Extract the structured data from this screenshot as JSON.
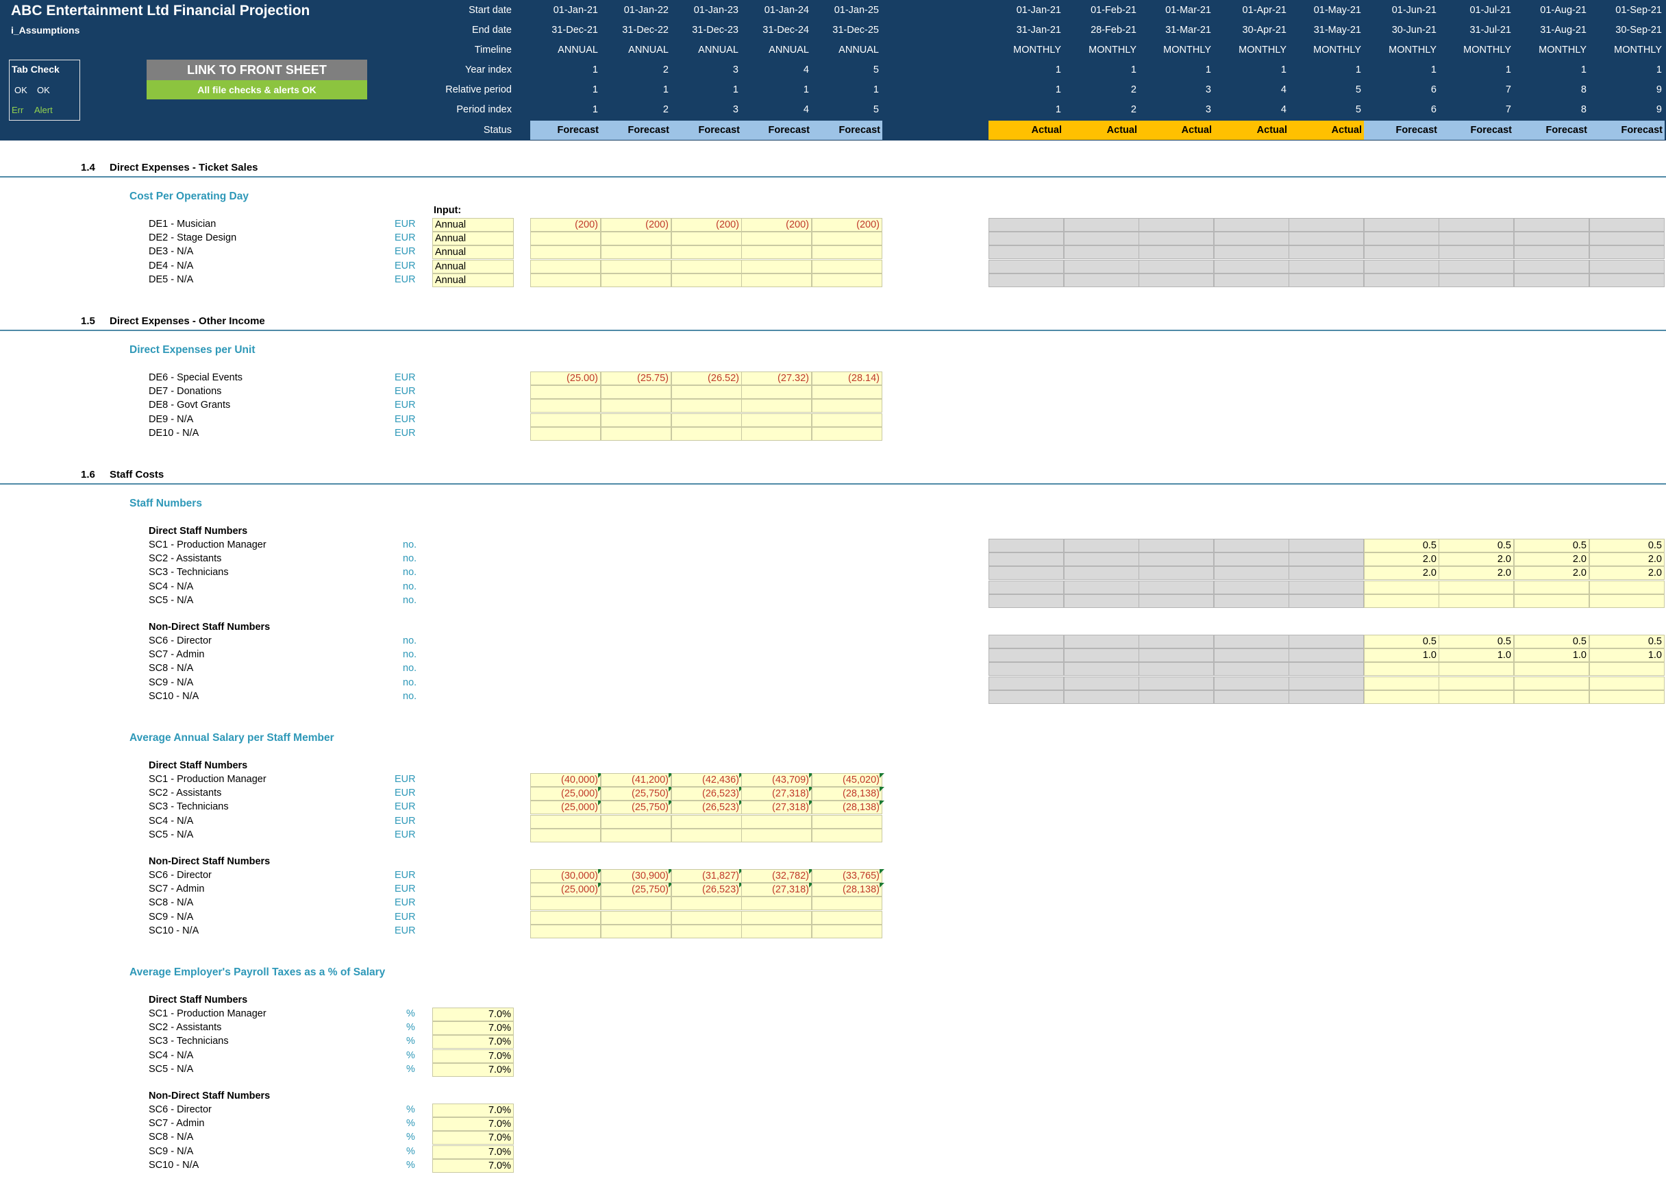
{
  "title": "ABC Entertainment Ltd Financial Projection",
  "sheet_name": "i_Assumptions",
  "tab_check": {
    "title": "Tab Check",
    "ok1": "OK",
    "ok2": "OK",
    "err": "Err",
    "alert": "Alert"
  },
  "link_button": "LINK TO FRONT SHEET",
  "alerts_status": "All file checks & alerts OK",
  "row_labels": {
    "start_date": "Start date",
    "end_date": "End date",
    "timeline": "Timeline",
    "year_index": "Year index",
    "relative_period": "Relative period",
    "period_index": "Period index",
    "status": "Status"
  },
  "annual_columns": [
    {
      "start": "01-Jan-21",
      "end": "31-Dec-21",
      "timeline": "ANNUAL",
      "year": "1",
      "rel": "1",
      "idx": "1",
      "status": "Forecast"
    },
    {
      "start": "01-Jan-22",
      "end": "31-Dec-22",
      "timeline": "ANNUAL",
      "year": "2",
      "rel": "1",
      "idx": "2",
      "status": "Forecast"
    },
    {
      "start": "01-Jan-23",
      "end": "31-Dec-23",
      "timeline": "ANNUAL",
      "year": "3",
      "rel": "1",
      "idx": "3",
      "status": "Forecast"
    },
    {
      "start": "01-Jan-24",
      "end": "31-Dec-24",
      "timeline": "ANNUAL",
      "year": "4",
      "rel": "1",
      "idx": "4",
      "status": "Forecast"
    },
    {
      "start": "01-Jan-25",
      "end": "31-Dec-25",
      "timeline": "ANNUAL",
      "year": "5",
      "rel": "1",
      "idx": "5",
      "status": "Forecast"
    }
  ],
  "monthly_columns": [
    {
      "start": "01-Jan-21",
      "end": "31-Jan-21",
      "timeline": "MONTHLY",
      "year": "1",
      "rel": "1",
      "idx": "1",
      "status": "Actual"
    },
    {
      "start": "01-Feb-21",
      "end": "28-Feb-21",
      "timeline": "MONTHLY",
      "year": "1",
      "rel": "2",
      "idx": "2",
      "status": "Actual"
    },
    {
      "start": "01-Mar-21",
      "end": "31-Mar-21",
      "timeline": "MONTHLY",
      "year": "1",
      "rel": "3",
      "idx": "3",
      "status": "Actual"
    },
    {
      "start": "01-Apr-21",
      "end": "30-Apr-21",
      "timeline": "MONTHLY",
      "year": "1",
      "rel": "4",
      "idx": "4",
      "status": "Actual"
    },
    {
      "start": "01-May-21",
      "end": "31-May-21",
      "timeline": "MONTHLY",
      "year": "1",
      "rel": "5",
      "idx": "5",
      "status": "Actual"
    },
    {
      "start": "01-Jun-21",
      "end": "30-Jun-21",
      "timeline": "MONTHLY",
      "year": "1",
      "rel": "6",
      "idx": "6",
      "status": "Forecast"
    },
    {
      "start": "01-Jul-21",
      "end": "31-Jul-21",
      "timeline": "MONTHLY",
      "year": "1",
      "rel": "7",
      "idx": "7",
      "status": "Forecast"
    },
    {
      "start": "01-Aug-21",
      "end": "31-Aug-21",
      "timeline": "MONTHLY",
      "year": "1",
      "rel": "8",
      "idx": "8",
      "status": "Forecast"
    },
    {
      "start": "01-Sep-21",
      "end": "30-Sep-21",
      "timeline": "MONTHLY",
      "year": "1",
      "rel": "9",
      "idx": "9",
      "status": "Forecast"
    }
  ],
  "colors": {
    "header_bg": "#173e64",
    "forecast": "#9dc3e6",
    "actual": "#ffc000",
    "input_yellow": "#ffffcc",
    "disabled_grey": "#d9d9d9",
    "accent_teal": "#2e98b8",
    "negative_red": "#c0392b",
    "link_grey": "#7f7f7f",
    "ok_green": "#8cc43f"
  },
  "sections": {
    "s14": {
      "num": "1.4",
      "title": "Direct Expenses - Ticket Sales",
      "sub": "Cost Per Operating Day",
      "input_label": "Input:",
      "rows": [
        {
          "label": "DE1 - Musician",
          "unit": "EUR",
          "input": "Annual",
          "values": [
            "(200)",
            "(200)",
            "(200)",
            "(200)",
            "(200)"
          ]
        },
        {
          "label": "DE2 - Stage Design",
          "unit": "EUR",
          "input": "Annual",
          "values": [
            "",
            "",
            "",
            "",
            ""
          ]
        },
        {
          "label": "DE3 - N/A",
          "unit": "EUR",
          "input": "Annual",
          "values": [
            "",
            "",
            "",
            "",
            ""
          ]
        },
        {
          "label": "DE4 - N/A",
          "unit": "EUR",
          "input": "Annual",
          "values": [
            "",
            "",
            "",
            "",
            ""
          ]
        },
        {
          "label": "DE5 - N/A",
          "unit": "EUR",
          "input": "Annual",
          "values": [
            "",
            "",
            "",
            "",
            ""
          ]
        }
      ]
    },
    "s15": {
      "num": "1.5",
      "title": "Direct Expenses - Other Income",
      "sub": "Direct Expenses per Unit",
      "rows": [
        {
          "label": "DE6 - Special Events",
          "unit": "EUR",
          "values": [
            "(25.00)",
            "(25.75)",
            "(26.52)",
            "(27.32)",
            "(28.14)"
          ]
        },
        {
          "label": "DE7 - Donations",
          "unit": "EUR",
          "values": [
            "",
            "",
            "",
            "",
            ""
          ]
        },
        {
          "label": "DE8 - Govt Grants",
          "unit": "EUR",
          "values": [
            "",
            "",
            "",
            "",
            ""
          ]
        },
        {
          "label": "DE9 - N/A",
          "unit": "EUR",
          "values": [
            "",
            "",
            "",
            "",
            ""
          ]
        },
        {
          "label": "DE10 - N/A",
          "unit": "EUR",
          "values": [
            "",
            "",
            "",
            "",
            ""
          ]
        }
      ]
    },
    "s16": {
      "num": "1.6",
      "title": "Staff Costs",
      "staff_numbers": {
        "sub": "Staff Numbers",
        "direct_title": "Direct Staff Numbers",
        "direct": [
          {
            "label": "SC1 - Production Manager",
            "unit": "no.",
            "monthly": [
              "0.5",
              "0.5",
              "0.5",
              "0.5"
            ]
          },
          {
            "label": "SC2 - Assistants",
            "unit": "no.",
            "monthly": [
              "2.0",
              "2.0",
              "2.0",
              "2.0"
            ]
          },
          {
            "label": "SC3 - Technicians",
            "unit": "no.",
            "monthly": [
              "2.0",
              "2.0",
              "2.0",
              "2.0"
            ]
          },
          {
            "label": "SC4 - N/A",
            "unit": "no.",
            "monthly": [
              "",
              "",
              "",
              ""
            ]
          },
          {
            "label": "SC5 - N/A",
            "unit": "no.",
            "monthly": [
              "",
              "",
              "",
              ""
            ]
          }
        ],
        "nondirect_title": "Non-Direct Staff Numbers",
        "nondirect": [
          {
            "label": "SC6 - Director",
            "unit": "no.",
            "monthly": [
              "0.5",
              "0.5",
              "0.5",
              "0.5"
            ]
          },
          {
            "label": "SC7 - Admin",
            "unit": "no.",
            "monthly": [
              "1.0",
              "1.0",
              "1.0",
              "1.0"
            ]
          },
          {
            "label": "SC8 - N/A",
            "unit": "no.",
            "monthly": [
              "",
              "",
              "",
              ""
            ]
          },
          {
            "label": "SC9 - N/A",
            "unit": "no.",
            "monthly": [
              "",
              "",
              "",
              ""
            ]
          },
          {
            "label": "SC10 - N/A",
            "unit": "no.",
            "monthly": [
              "",
              "",
              "",
              ""
            ]
          }
        ]
      },
      "salary": {
        "sub": "Average Annual Salary per Staff Member",
        "direct_title": "Direct Staff Numbers",
        "direct": [
          {
            "label": "SC1 - Production Manager",
            "unit": "EUR",
            "values": [
              "(40,000)",
              "(41,200)",
              "(42,436)",
              "(43,709)",
              "(45,020)"
            ]
          },
          {
            "label": "SC2 - Assistants",
            "unit": "EUR",
            "values": [
              "(25,000)",
              "(25,750)",
              "(26,523)",
              "(27,318)",
              "(28,138)"
            ]
          },
          {
            "label": "SC3 - Technicians",
            "unit": "EUR",
            "values": [
              "(25,000)",
              "(25,750)",
              "(26,523)",
              "(27,318)",
              "(28,138)"
            ]
          },
          {
            "label": "SC4 - N/A",
            "unit": "EUR",
            "values": [
              "",
              "",
              "",
              "",
              ""
            ]
          },
          {
            "label": "SC5 - N/A",
            "unit": "EUR",
            "values": [
              "",
              "",
              "",
              "",
              ""
            ]
          }
        ],
        "nondirect_title": "Non-Direct Staff Numbers",
        "nondirect": [
          {
            "label": "SC6 - Director",
            "unit": "EUR",
            "values": [
              "(30,000)",
              "(30,900)",
              "(31,827)",
              "(32,782)",
              "(33,765)"
            ]
          },
          {
            "label": "SC7 - Admin",
            "unit": "EUR",
            "values": [
              "(25,000)",
              "(25,750)",
              "(26,523)",
              "(27,318)",
              "(28,138)"
            ]
          },
          {
            "label": "SC8 - N/A",
            "unit": "EUR",
            "values": [
              "",
              "",
              "",
              "",
              ""
            ]
          },
          {
            "label": "SC9 - N/A",
            "unit": "EUR",
            "values": [
              "",
              "",
              "",
              "",
              ""
            ]
          },
          {
            "label": "SC10 - N/A",
            "unit": "EUR",
            "values": [
              "",
              "",
              "",
              "",
              ""
            ]
          }
        ]
      },
      "payroll": {
        "sub": "Average Employer's Payroll Taxes as a % of Salary",
        "direct_title": "Direct Staff Numbers",
        "direct": [
          {
            "label": "SC1 - Production Manager",
            "unit": "%",
            "value": "7.0%"
          },
          {
            "label": "SC2 - Assistants",
            "unit": "%",
            "value": "7.0%"
          },
          {
            "label": "SC3 - Technicians",
            "unit": "%",
            "value": "7.0%"
          },
          {
            "label": "SC4 - N/A",
            "unit": "%",
            "value": "7.0%"
          },
          {
            "label": "SC5 - N/A",
            "unit": "%",
            "value": "7.0%"
          }
        ],
        "nondirect_title": "Non-Direct Staff Numbers",
        "nondirect": [
          {
            "label": "SC6 - Director",
            "unit": "%",
            "value": "7.0%"
          },
          {
            "label": "SC7 - Admin",
            "unit": "%",
            "value": "7.0%"
          },
          {
            "label": "SC8 - N/A",
            "unit": "%",
            "value": "7.0%"
          },
          {
            "label": "SC9 - N/A",
            "unit": "%",
            "value": "7.0%"
          },
          {
            "label": "SC10 - N/A",
            "unit": "%",
            "value": "7.0%"
          }
        ]
      }
    }
  }
}
